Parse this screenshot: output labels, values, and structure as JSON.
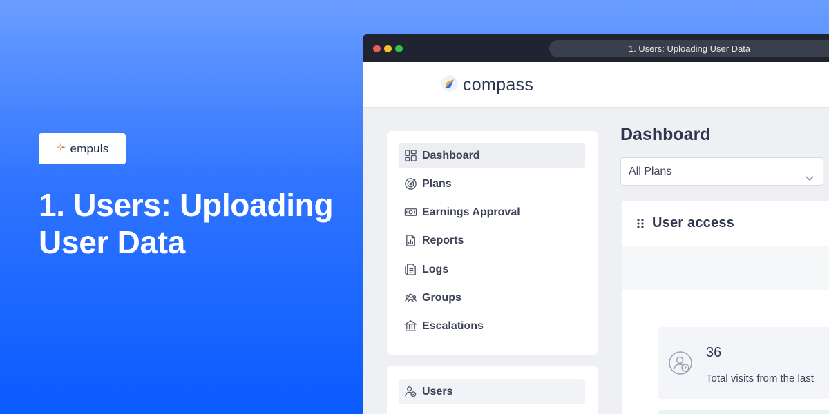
{
  "hero": {
    "brand": "empuls",
    "title": "1. Users: Uploading User Data"
  },
  "browser": {
    "tab_title": "1. Users: Uploading User Data"
  },
  "app": {
    "brand": "compass"
  },
  "sidebar": {
    "items": [
      {
        "label": "Dashboard",
        "icon": "dashboard-icon"
      },
      {
        "label": "Plans",
        "icon": "target-icon"
      },
      {
        "label": "Earnings Approval",
        "icon": "money-icon"
      },
      {
        "label": "Reports",
        "icon": "report-icon"
      },
      {
        "label": "Logs",
        "icon": "logs-icon"
      },
      {
        "label": "Groups",
        "icon": "groups-icon"
      },
      {
        "label": "Escalations",
        "icon": "bank-icon"
      }
    ],
    "secondary": [
      {
        "label": "Users",
        "icon": "users-icon"
      }
    ]
  },
  "main": {
    "title": "Dashboard",
    "plan_filter": "All Plans",
    "widget": {
      "title": "User access",
      "stat_value": "36",
      "stat_label": "Total visits from the last"
    }
  },
  "colors": {
    "hero_gradient_top": "#6a9dff",
    "hero_gradient_bottom": "#0a5bff",
    "titlebar": "#1f2430"
  }
}
